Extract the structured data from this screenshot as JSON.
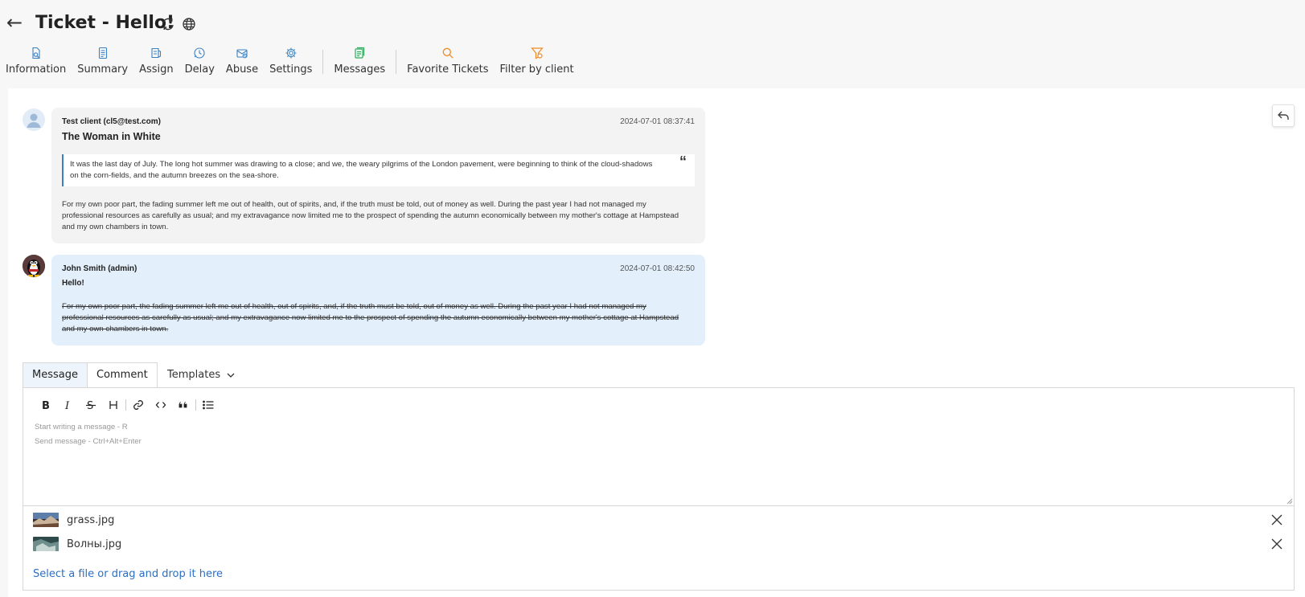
{
  "header": {
    "back_glyph": "←",
    "title": "Ticket - Hello!",
    "icons": [
      "refresh-icon",
      "globe-icon"
    ]
  },
  "toolbar": {
    "items": [
      {
        "label": "Information",
        "icon": "information-icon",
        "color": "#3b82c4"
      },
      {
        "label": "Summary",
        "icon": "summary-icon",
        "color": "#3b82c4"
      },
      {
        "label": "Assign",
        "icon": "assign-icon",
        "color": "#3b82c4"
      },
      {
        "label": "Delay",
        "icon": "delay-icon",
        "color": "#3b82c4"
      },
      {
        "label": "Abuse",
        "icon": "abuse-icon",
        "color": "#3b82c4"
      },
      {
        "label": "Settings",
        "icon": "settings-icon",
        "color": "#3b82c4"
      },
      {
        "label": "Messages",
        "icon": "messages-icon",
        "color": "#2eaa5c"
      },
      {
        "label": "Favorite Tickets",
        "icon": "search-icon",
        "color": "#f08a24"
      },
      {
        "label": "Filter by client",
        "icon": "filter-icon",
        "color": "#f08a24"
      }
    ]
  },
  "messages": [
    {
      "author": "Test client (cl5@test.com)",
      "date": "2024-07-01 08:37:41",
      "subject": "The Woman in White",
      "quote": "It was the last day of July. The long hot summer was drawing to a close; and we, the weary pilgrims of the London pavement, were beginning to think of the cloud-shadows on the corn-fields, and the autumn breezes on the sea-shore.",
      "quote_mark": "“",
      "body": "For my own poor part, the fading summer left me out of health, out of spirits, and, if the truth must be told, out of money as well. During the past year I had not managed my professional resources as carefully as usual; and my extravagance now limited me to the prospect of spending the autumn economically between my mother's cottage at Hampstead and my own chambers in town."
    },
    {
      "author": "John Smith (admin)",
      "date": "2024-07-01 08:42:50",
      "greeting": "Hello!",
      "body": "For my own poor part, the fading summer left me out of health, out of spirits, and, if the truth must be told, out of money as well. During the past year I had not managed my professional resources as carefully as usual; and my extravagance now limited me to the prospect of spending the autumn economically between my mother's cottage at Hampstead and my own chambers in town."
    }
  ],
  "composer": {
    "tabs": [
      "Message",
      "Comment"
    ],
    "active_tab": "Message",
    "templates_label": "Templates",
    "format_buttons": [
      "bold",
      "italic",
      "strikethrough",
      "heading",
      "link",
      "code",
      "quote",
      "list"
    ],
    "placeholder_line1": "Start writing a message - R",
    "placeholder_line2": "Send message - Ctrl+Alt+Enter"
  },
  "attachments": [
    {
      "name": "grass.jpg"
    },
    {
      "name": "Волны.jpg"
    }
  ],
  "upload_label": "Select a file or drag and drop it here",
  "colors": {
    "accent": "#3b82c4",
    "admin_bubble": "#e3effb",
    "client_bubble": "#f3f3f3",
    "link": "#2b6fc2"
  }
}
